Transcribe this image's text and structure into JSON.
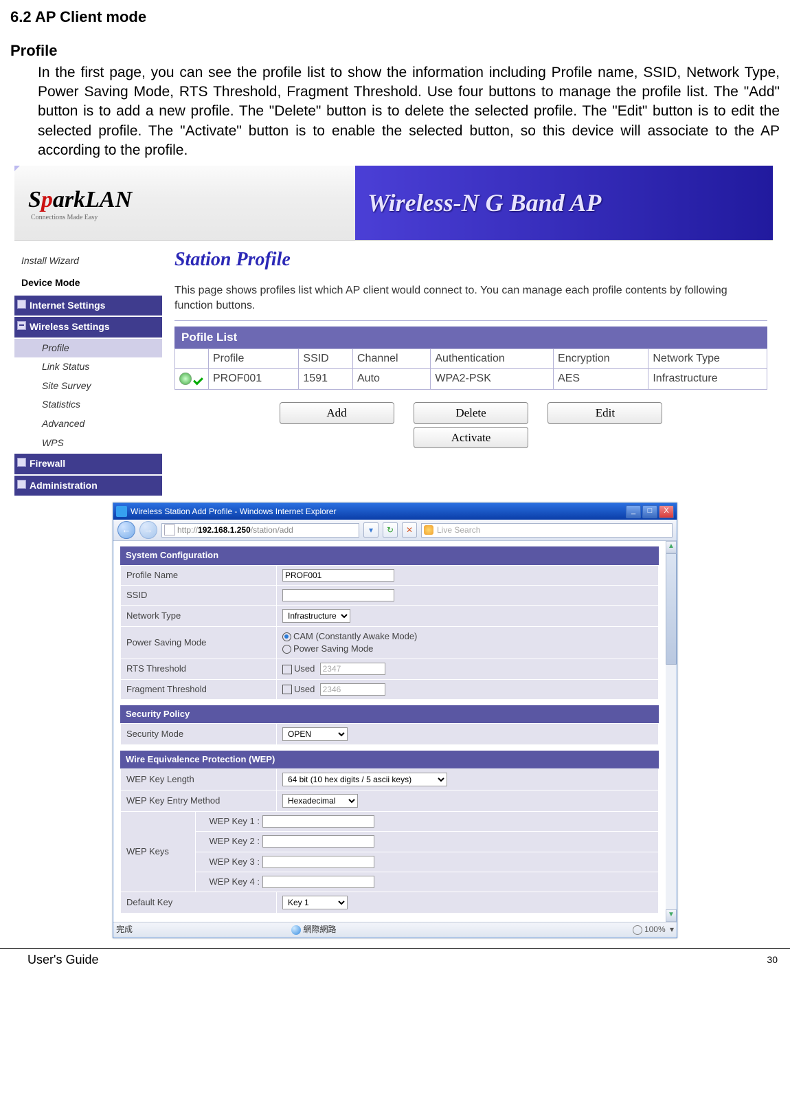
{
  "doc": {
    "section_title": "6.2 AP Client mode",
    "sub_title": "Profile",
    "body_text": "In the first page, you can see the profile list to show the information including Profile name, SSID, Network Type, Power Saving Mode, RTS Threshold, Fragment Threshold. Use four buttons to manage the profile list. The \"Add\" button is to add a new profile. The \"Delete\" button is to delete the selected profile. The \"Edit\" button is to edit the selected profile. The \"Activate\" button is to enable the selected button, so this device will associate to the AP according to the profile."
  },
  "banner": {
    "logo_s": "S",
    "logo_p": "p",
    "logo_rest": "arkLAN",
    "logo_tag": "Connections Made Easy",
    "title": "Wireless-N G Band AP"
  },
  "sidebar": {
    "install": "Install Wizard",
    "devmode": "Device Mode",
    "internet": "Internet Settings",
    "wireless": "Wireless Settings",
    "subs": [
      "Profile",
      "Link Status",
      "Site Survey",
      "Statistics",
      "Advanced",
      "WPS"
    ],
    "firewall": "Firewall",
    "admin": "Administration"
  },
  "content": {
    "heading": "Station Profile",
    "desc": "This page shows profiles list which AP client would connect to. You can manage each profile contents by following function buttons.",
    "list_title": "Pofile List",
    "cols": [
      "",
      "Profile",
      "SSID",
      "Channel",
      "Authentication",
      "Encryption",
      "Network Type"
    ],
    "row": [
      "",
      "PROF001",
      "1591",
      "Auto",
      "WPA2-PSK",
      "AES",
      "Infrastructure"
    ],
    "buttons": [
      "Add",
      "Delete",
      "Edit",
      "Activate"
    ]
  },
  "ie": {
    "title": "Wireless Station Add Profile  -  Windows Internet Explorer",
    "url_prefix": "http://",
    "url_ip": "192.168.1.250",
    "url_rest": "/station/add",
    "search_ph": "Live Search",
    "status_done": "完成",
    "status_net": "網際網路",
    "zoom": "100%"
  },
  "cfg": {
    "sys_head": "System Configuration",
    "profile_name_lab": "Profile Name",
    "profile_name_val": "PROF001",
    "ssid_lab": "SSID",
    "ssid_val": "",
    "net_lab": "Network Type",
    "net_val": "Infrastructure",
    "psm_lab": "Power Saving Mode",
    "psm_opt1": "CAM (Constantly Awake Mode)",
    "psm_opt2": "Power Saving Mode",
    "rts_lab": "RTS Threshold",
    "rts_used": "Used",
    "rts_val": "2347",
    "frag_lab": "Fragment Threshold",
    "frag_used": "Used",
    "frag_val": "2346",
    "sec_head": "Security Policy",
    "secmode_lab": "Security Mode",
    "secmode_val": "OPEN",
    "wep_head": "Wire Equivalence Protection (WEP)",
    "weplen_lab": "WEP Key Length",
    "weplen_val": "64 bit (10 hex digits / 5 ascii keys)",
    "wepent_lab": "WEP Key Entry Method",
    "wepent_val": "Hexadecimal",
    "wepkeys_lab": "WEP Keys",
    "wepk1": "WEP Key 1 :",
    "wepk2": "WEP Key 2 :",
    "wepk3": "WEP Key 3 :",
    "wepk4": "WEP Key 4 :",
    "defkey_lab": "Default Key",
    "defkey_val": "Key 1"
  },
  "footer": {
    "guide": "User's Guide",
    "page": "30"
  }
}
